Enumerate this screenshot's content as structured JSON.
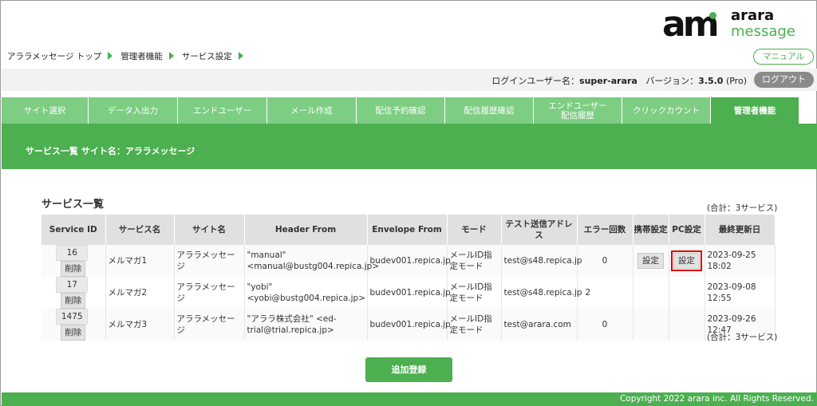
{
  "logo": {
    "mark": "am",
    "top": "arara",
    "bottom": "message"
  },
  "breadcrumb": [
    "アララメッセージ トップ",
    "管理者機能",
    "サービス設定"
  ],
  "manual_label": "マニュアル",
  "user": {
    "login_label": "ログインユーザー名：",
    "login_name": "super-arara",
    "version_label": "バージョン：",
    "version": "3.5.0",
    "edition": "(Pro)",
    "logout_label": "ログアウト"
  },
  "tabs": [
    {
      "label": "サイト選択",
      "active": false
    },
    {
      "label": "データ入出力",
      "active": false
    },
    {
      "label": "エンドユーザー",
      "active": false
    },
    {
      "label": "メール作成",
      "active": false
    },
    {
      "label": "配信予約確認",
      "active": false
    },
    {
      "label": "配信履歴確認",
      "active": false
    },
    {
      "label": "エンドユーザー\n配信履歴",
      "active": false
    },
    {
      "label": "クリックカウント",
      "active": false
    },
    {
      "label": "管理者機能",
      "active": true
    }
  ],
  "banner": "サービス一覧 サイト名：アララメッセージ",
  "list": {
    "title": "サービス一覧",
    "total": "(合計：3サービス)",
    "headers": [
      "Service ID",
      "サービス名",
      "サイト名",
      "Header From",
      "Envelope From",
      "モード",
      "テスト送信アドレス",
      "エラー回数",
      "携帯設定",
      "PC設定",
      "最終更新日"
    ],
    "delete_label": "削除",
    "set_label": "設定",
    "rows": [
      {
        "id": "16",
        "name": "メルマガ1",
        "site": "アララメッセージ",
        "header_from": "\"manual\" <manual@bustg004.repica.jp>",
        "envelope_from": "budev001.repica.jp",
        "mode": "メールID指定モード",
        "test_addr": "test@s48.repica.jp",
        "errors": "0",
        "mobile": true,
        "pc": true,
        "updated": "2023-09-25 18:02"
      },
      {
        "id": "17",
        "name": "メルマガ2",
        "site": "アララメッセージ",
        "header_from": "\"yobi\" <yobi@bustg004.repica.jp>",
        "envelope_from": "budev001.repica.jp",
        "mode": "メールID指定モード",
        "test_addr": "test@s48.repica.jp",
        "errors": "2",
        "mobile": false,
        "pc": false,
        "updated": "2023-09-08 12:55"
      },
      {
        "id": "1475",
        "name": "メルマガ3",
        "site": "アララメッセージ",
        "header_from": "\"アララ株式会社\" <ed-trial@trial.repica.jp>",
        "envelope_from": "budev001.repica.jp",
        "mode": "メールID指定モード",
        "test_addr": "test@arara.com",
        "errors": "0",
        "mobile": false,
        "pc": false,
        "updated": "2023-09-26 12:47"
      }
    ]
  },
  "add_label": "追加登録",
  "footer": "Copyright 2022 arara inc. All Rights Reserved.",
  "colors": {
    "accent": "#4caf50",
    "tab": "#7dcd83",
    "highlight": "#e00000"
  }
}
